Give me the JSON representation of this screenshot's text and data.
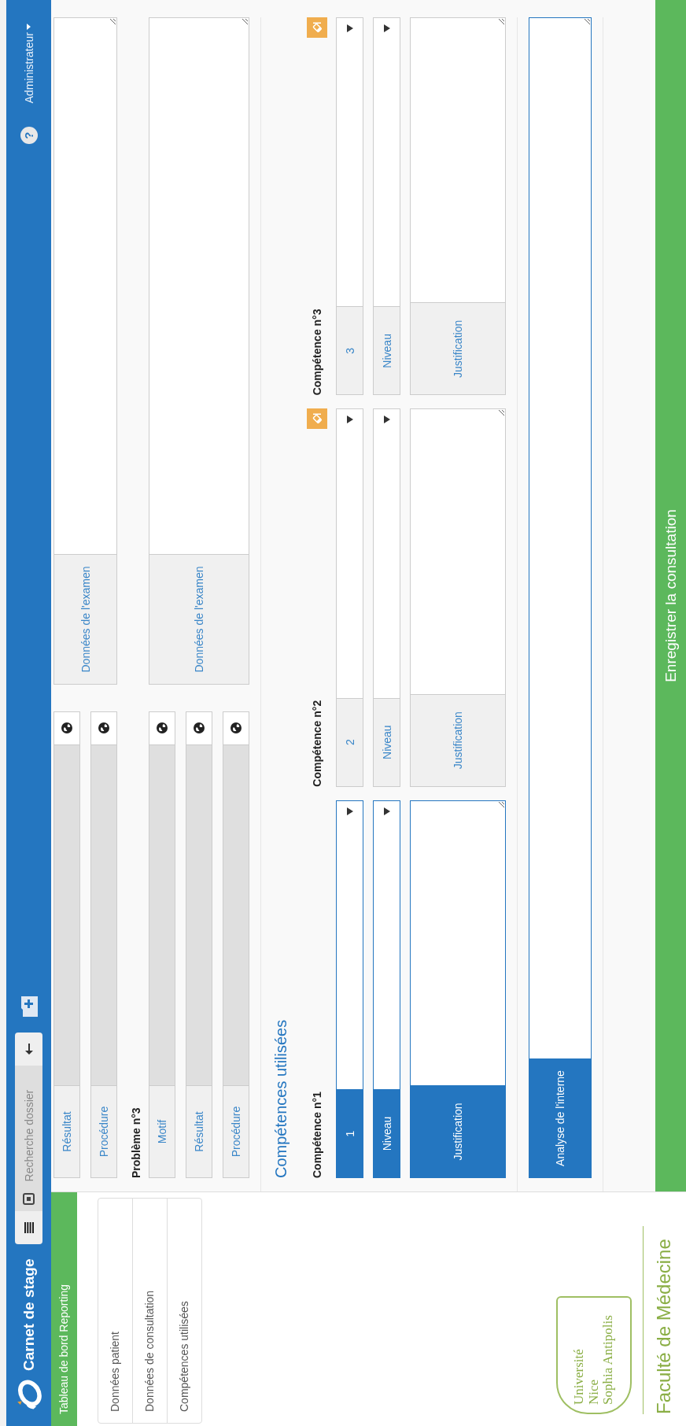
{
  "navbar": {
    "title": "Carnet de stage",
    "search": {
      "placeholder": "Recherche dossier"
    },
    "help": "?",
    "user": "Administrateur"
  },
  "sidebar": {
    "dashboard_link": "Tableau de bord Reporting",
    "items": [
      {
        "label": "Données patient"
      },
      {
        "label": "Données de consultation"
      },
      {
        "label": "Compétences utilisées"
      }
    ],
    "logo_lines": [
      "Université",
      "Nice",
      "Sophia Antipolis"
    ],
    "faculty": "Faculté de Médecine"
  },
  "problems": [
    {
      "fields": [
        {
          "label": "Résultat",
          "disabled": true
        },
        {
          "label": "Procédure",
          "disabled": true
        }
      ],
      "exam_label": "Données de l'examen"
    },
    {
      "title": "Problème n°3",
      "fields": [
        {
          "label": "Motif",
          "disabled": true
        },
        {
          "label": "Résultat",
          "disabled": true
        },
        {
          "label": "Procédure",
          "disabled": true
        }
      ],
      "exam_label": "Données de l'examen"
    }
  ],
  "competences": {
    "title": "Compétences utilisées",
    "columns": [
      {
        "title": "Compétence n°1",
        "number": "1",
        "level_label": "Niveau",
        "justification_label": "Justification",
        "selected": true,
        "clear_button": false
      },
      {
        "title": "Compétence n°2",
        "number": "2",
        "level_label": "Niveau",
        "justification_label": "Justification",
        "selected": false,
        "clear_button": true
      },
      {
        "title": "Compétence n°3",
        "number": "3",
        "level_label": "Niveau",
        "justification_label": "Justification",
        "selected": false,
        "clear_button": true
      }
    ]
  },
  "analysis": {
    "label": "Analyse de l'interne",
    "selected": true
  },
  "footer": {
    "button": "Enregistrer la consultation"
  }
}
